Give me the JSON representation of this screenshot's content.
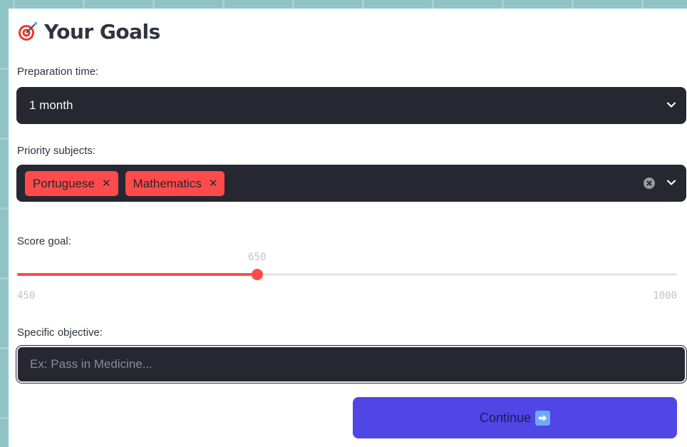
{
  "header": {
    "title": "Your Goals",
    "icon": "target-dart-icon"
  },
  "preparation": {
    "label": "Preparation time:",
    "value": "1 month"
  },
  "priority": {
    "label": "Priority subjects:",
    "tags": [
      "Portuguese",
      "Mathematics"
    ],
    "tag_color": "#ff4b4b"
  },
  "score": {
    "label": "Score goal:",
    "value": "650",
    "min": "450",
    "max": "1000",
    "accent": "#ff4b4b"
  },
  "objective": {
    "label": "Specific objective:",
    "placeholder": "Ex: Pass in Medicine...",
    "value": ""
  },
  "continue_button": {
    "label": "Continue",
    "icon": "right-arrow-icon",
    "color": "#4f46e5"
  }
}
